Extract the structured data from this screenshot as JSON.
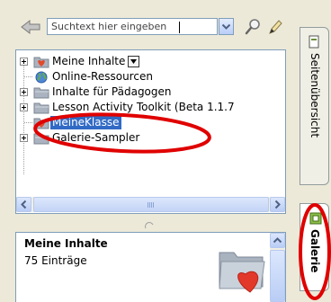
{
  "search": {
    "value": "Suchtext hier eingeben",
    "icons": [
      "back-arrow-icon",
      "chevron-down-icon",
      "magnifier-icon",
      "pencil-icon"
    ]
  },
  "tree": {
    "items": [
      {
        "label": "Meine Inhalte",
        "expandable": true,
        "icon": "folder-heart-icon"
      },
      {
        "label": "Online-Ressourcen",
        "expandable": false,
        "icon": "globe-icon"
      },
      {
        "label": "Inhalte für Pädagogen",
        "expandable": true,
        "icon": "folder-icon"
      },
      {
        "label": "Lesson Activity Toolkit (Beta 1.1.7",
        "expandable": true,
        "icon": "folder-icon"
      },
      {
        "label": "MeineKlasse",
        "expandable": false,
        "icon": "folder-heart-icon",
        "selected": true
      },
      {
        "label": "Galerie-Sampler",
        "expandable": true,
        "icon": "folder-icon"
      }
    ]
  },
  "info": {
    "title": "Meine Inhalte",
    "count": "75 Einträge"
  },
  "tabs": [
    {
      "label": "Seitenübersicht",
      "active": false
    },
    {
      "label": "Galerie",
      "active": true
    }
  ],
  "colors": {
    "selection": "#316ac5",
    "annotation": "#e00000",
    "panel_bg": "#ece9d8"
  }
}
